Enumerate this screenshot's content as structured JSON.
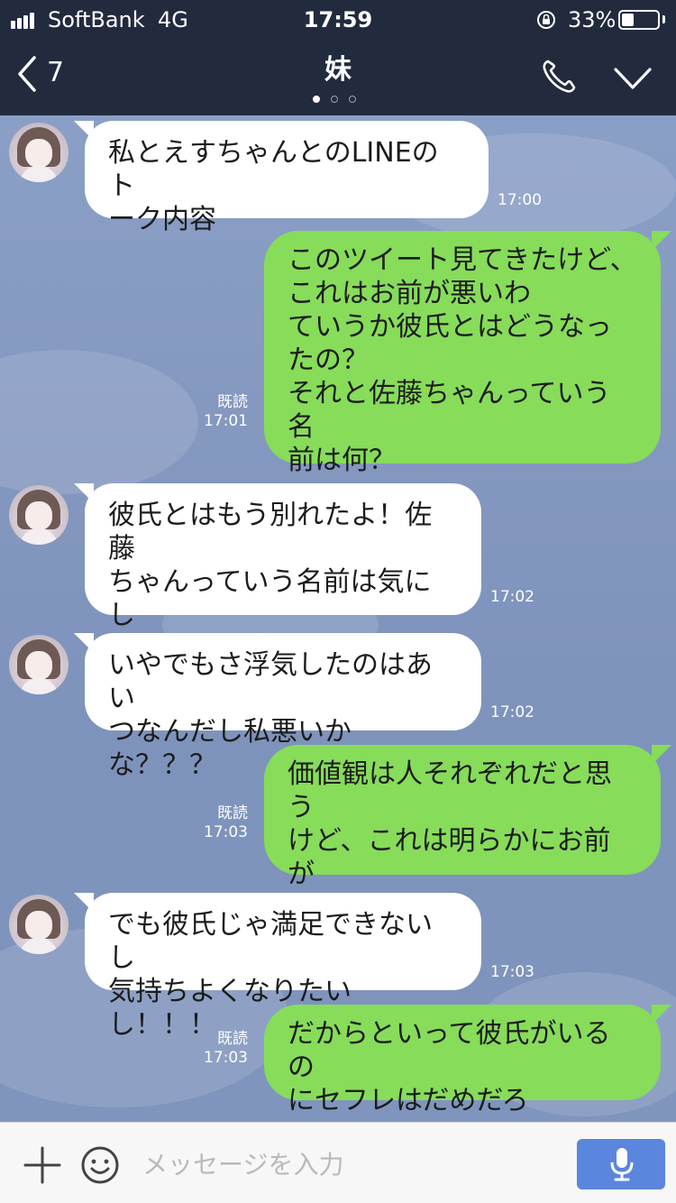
{
  "status_bar": {
    "carrier": "SoftBank",
    "network": "4G",
    "time": "17:59",
    "battery_percent_label": "33%",
    "battery_level": 0.33
  },
  "nav": {
    "back_count": "7",
    "title": "妹",
    "page_count": 3,
    "active_page": 0
  },
  "messages": [
    {
      "side": "in",
      "text": "私とえすちゃんとのLINEのト\nーク内容",
      "time": "17:00"
    },
    {
      "side": "out",
      "text": "このツイート見てきたけど、\nこれはお前が悪いわ\nていうか彼氏とはどうなっ\nたの？\nそれと佐藤ちゃんっていう名\n前は何？",
      "read": "既読",
      "time": "17:01"
    },
    {
      "side": "in",
      "text": "彼氏とはもう別れたよ！佐藤\nちゃんっていう名前は気にし\nないで！",
      "time": "17:02"
    },
    {
      "side": "in",
      "text": "いやでもさ浮気したのはあい\nつなんだし私悪いかな？？？",
      "time": "17:02"
    },
    {
      "side": "out",
      "text": "価値観は人それぞれだと思う\nけど、これは明らかにお前が\n悪いと思うぞ",
      "read": "既読",
      "time": "17:03"
    },
    {
      "side": "in",
      "text": "でも彼氏じゃ満足できないし\n気持ちよくなりたいし！！！",
      "time": "17:03"
    },
    {
      "side": "out",
      "text": "だからといって彼氏がいるの\nにセフレはだめだろ",
      "read": "既読",
      "time": "17:03"
    }
  ],
  "input": {
    "placeholder": "メッセージを入力"
  },
  "colors": {
    "header_bg": "#222b3e",
    "chat_bg": "#8498c0",
    "incoming_bubble": "#ffffff",
    "outgoing_bubble": "#87dc5a",
    "mic_button": "#5b86dd"
  },
  "icons": {
    "back": "chevron-left-icon",
    "call": "phone-icon",
    "menu": "chevron-down-icon",
    "plus": "plus-icon",
    "emoji": "smiley-icon",
    "mic": "microphone-icon",
    "rotation_lock": "rotation-lock-icon"
  }
}
